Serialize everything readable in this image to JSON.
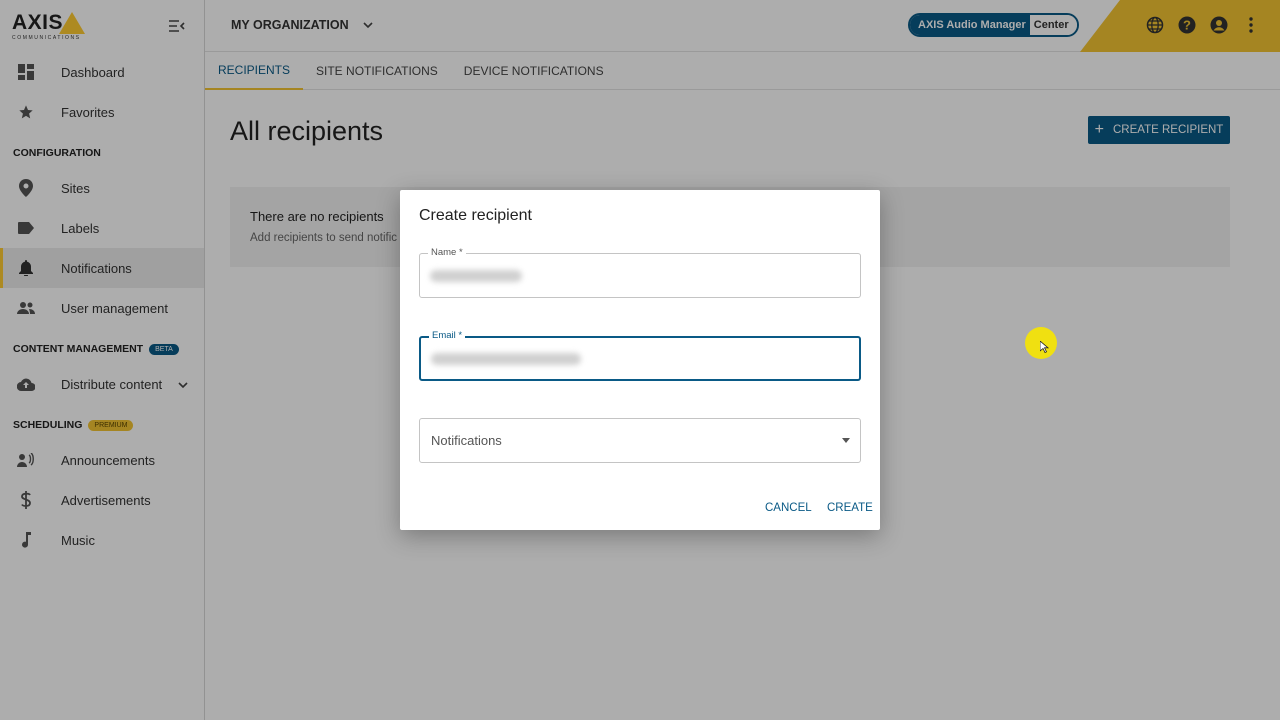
{
  "sidebar": {
    "logo_main": "AXIS",
    "logo_sub": "COMMUNICATIONS",
    "items_top": [
      {
        "label": "Dashboard",
        "icon": "dashboard-icon"
      },
      {
        "label": "Favorites",
        "icon": "star-icon"
      }
    ],
    "config_section": "CONFIGURATION",
    "config_items": [
      {
        "label": "Sites",
        "icon": "location-pin-icon"
      },
      {
        "label": "Labels",
        "icon": "label-tag-icon"
      },
      {
        "label": "Notifications",
        "icon": "bell-icon"
      },
      {
        "label": "User management",
        "icon": "users-icon"
      }
    ],
    "content_section": "CONTENT MANAGEMENT",
    "content_badge": "BETA",
    "content_items": [
      {
        "label": "Distribute content",
        "icon": "cloud-upload-icon"
      }
    ],
    "scheduling_section": "SCHEDULING",
    "scheduling_badge": "PREMIUM",
    "scheduling_items": [
      {
        "label": "Announcements",
        "icon": "speaker-person-icon"
      },
      {
        "label": "Advertisements",
        "icon": "dollar-icon"
      },
      {
        "label": "Music",
        "icon": "music-note-icon"
      }
    ]
  },
  "topbar": {
    "organization": "MY ORGANIZATION",
    "product_a": "AXIS Audio Manager",
    "product_b": "Center"
  },
  "tabs": [
    "RECIPIENTS",
    "SITE NOTIFICATIONS",
    "DEVICE NOTIFICATIONS"
  ],
  "main": {
    "title": "All recipients",
    "create_button": "CREATE RECIPIENT",
    "empty_title": "There are no recipients",
    "empty_sub": "Add recipients to send notific"
  },
  "dialog": {
    "title": "Create recipient",
    "name_label": "Name *",
    "email_label": "Email *",
    "notifications_placeholder": "Notifications",
    "cancel": "CANCEL",
    "create": "CREATE"
  },
  "colors": {
    "accent": "#0a5a86",
    "brand_yellow": "#f3c533"
  }
}
